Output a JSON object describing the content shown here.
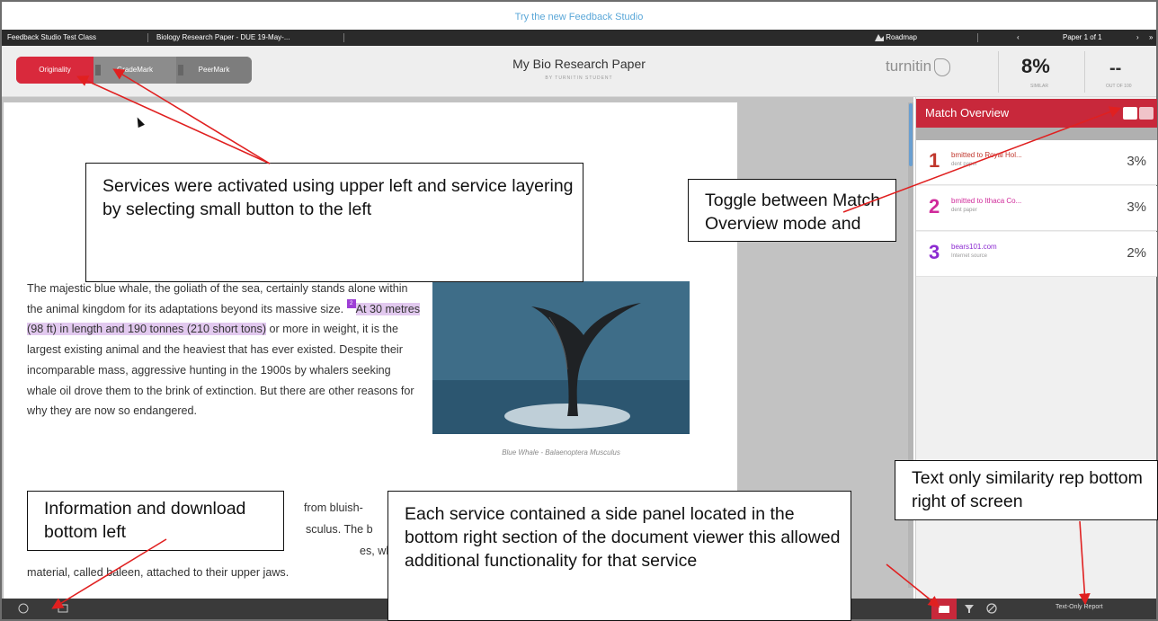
{
  "banner": {
    "text": "Try the new Feedback Studio"
  },
  "breadcrumb": {
    "class_name": "Feedback Studio Test Class",
    "assignment": "Biology Research Paper - DUE 19-May-...",
    "roadmap": "Roadmap",
    "paper_position": "Paper 1 of 1"
  },
  "services": {
    "originality": "Originality",
    "grademark": "GradeMark",
    "peermark": "PeerMark"
  },
  "document": {
    "title": "My Bio Research Paper",
    "author": "BY TURNITIN STUDENT",
    "image_caption": "Blue Whale - Balaenoptera Musculus",
    "para1_a": "The majestic blue whale, the goliath of the sea, certainly stands alone within the animal kingdom for its adaptations beyond its massive size. ",
    "para1_highlight": "At 30 metres (98 ft) in length and 190 tonnes (210 short tons)",
    "para1_b": " or more in weight, it is the largest existing animal and the heaviest that has ever existed. Despite their incomparable mass, aggressive hunting in the 1900s by whalers seeking whale oil drove them to the brink of extinction. But there are other reasons for why they are now so endangered.",
    "para2_line1": "from bluish-",
    "para2_line2": "sculus. The b",
    "para2_line3": "es, which m",
    "para2_line4": "material, called baleen, attached to their upper jaws."
  },
  "header_right": {
    "logo_text": "turnitin",
    "similarity": "8%",
    "similarity_label": "SIMILAR",
    "grade": "--",
    "grade_label": "OUT OF 100"
  },
  "side_panel": {
    "title": "Match Overview",
    "matches": [
      {
        "num": "1",
        "name": "bmitted to Royal Hol...",
        "type": "dent paper",
        "pct": "3%",
        "color": "#c0362c"
      },
      {
        "num": "2",
        "name": "bmitted to Ithaca Co...",
        "type": "dent paper",
        "pct": "3%",
        "color": "#d02a9a"
      },
      {
        "num": "3",
        "name": "bears101.com",
        "type": "Internet source",
        "pct": "2%",
        "color": "#8c2bd1"
      }
    ]
  },
  "bottom_bar": {
    "text_only": "Text-Only Report"
  },
  "annotations": {
    "services": "Services were activated using upper left and service layering by selecting small button to the left",
    "toggle": "Toggle between Match Overview mode and",
    "info": "Information and download bottom left",
    "side_panel": "Each service contained a side panel located in the bottom right section of the document viewer this allowed additional functionality for that service",
    "text_only": "Text only similarity rep bottom right of screen"
  },
  "colors": {
    "accent_red": "#c8283b",
    "highlight_purple": "#e2c9ef",
    "banner_blue": "#5aa7d8"
  }
}
